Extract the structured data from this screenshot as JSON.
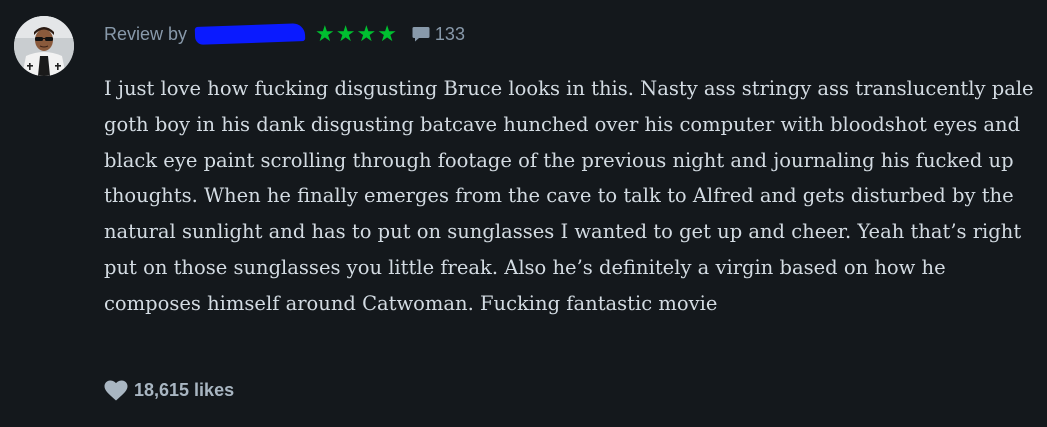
{
  "review": {
    "review_by_label": "Review by",
    "rating_stars": "★★★★",
    "comment_count": "133",
    "text": "I just love how fucking disgusting Bruce looks in this. Nasty ass stringy ass translucently pale goth boy in his dank disgusting batcave hunched over his computer with bloodshot eyes and black eye paint scrolling through footage of the previous night and journaling his fucked up thoughts. When he finally emerges from the cave to talk to Alfred and gets disturbed by the natural sunlight and has to put on sunglasses I wanted to get up and cheer. Yeah that’s right put on those sunglasses you little freak. Also he’s definitely a virgin based on how he composes himself around Catwoman. Fucking fantastic movie",
    "likes": "18,615 likes"
  },
  "colors": {
    "background": "#14181c",
    "star": "#00c030",
    "muted_text": "#8899aa",
    "body_text": "#d3dbe2",
    "redaction": "#0a1aff"
  },
  "icons": {
    "comment": "speech-bubble-icon",
    "like": "heart-icon"
  }
}
